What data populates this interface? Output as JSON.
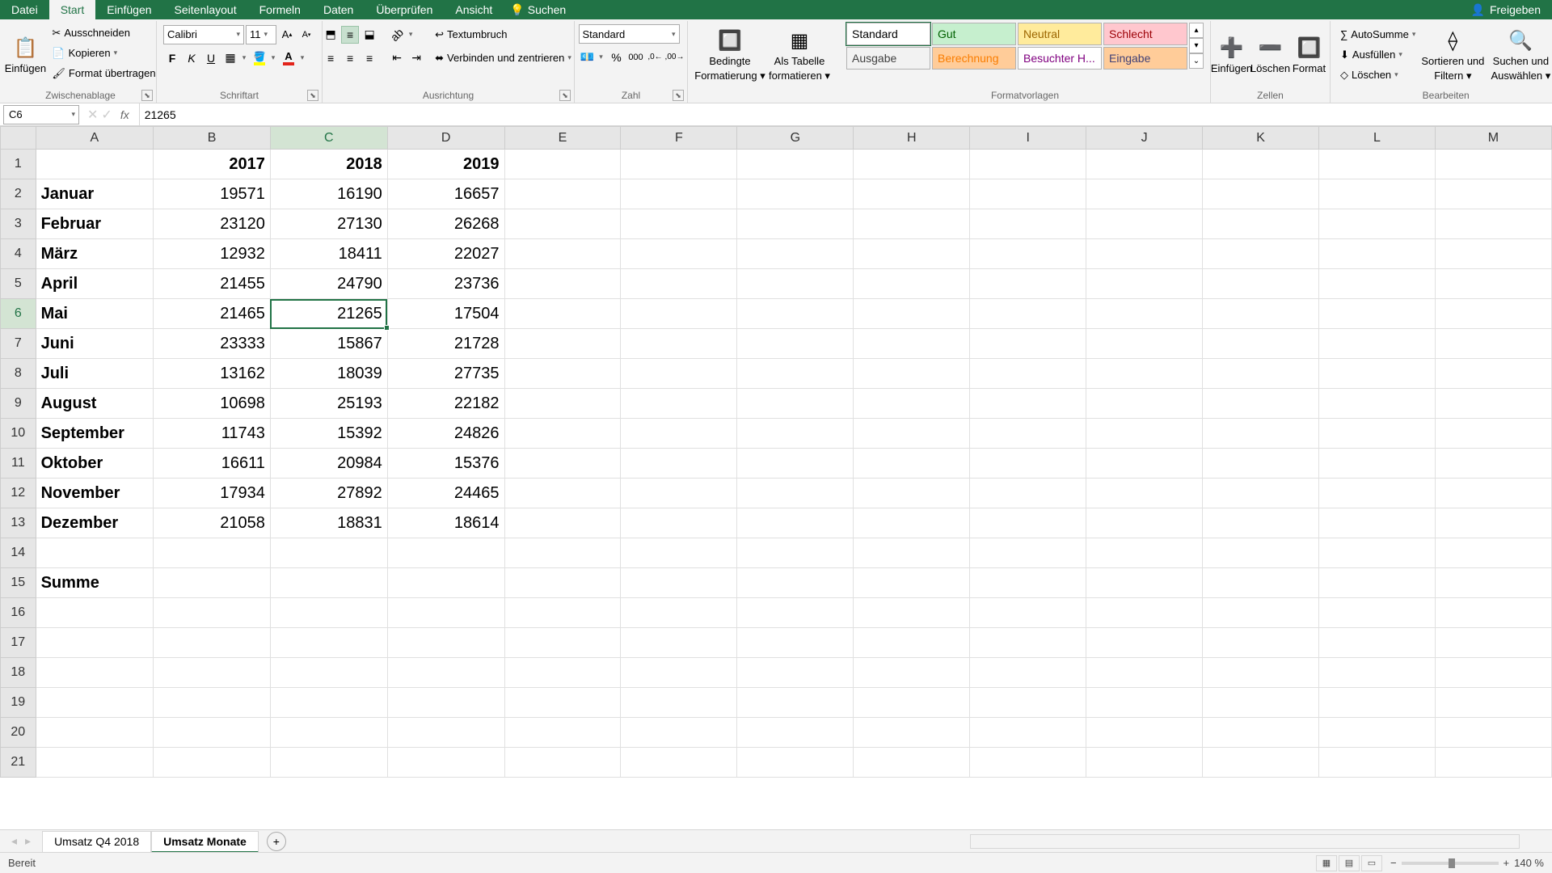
{
  "title_tabs": [
    "Datei",
    "Start",
    "Einfügen",
    "Seitenlayout",
    "Formeln",
    "Daten",
    "Überprüfen",
    "Ansicht"
  ],
  "active_tab": "Start",
  "search_label": "Suchen",
  "share_label": "Freigeben",
  "clipboard": {
    "paste": "Einfügen",
    "cut": "Ausschneiden",
    "copy": "Kopieren",
    "format_paint": "Format übertragen",
    "group": "Zwischenablage"
  },
  "font": {
    "group": "Schriftart",
    "name": "Calibri",
    "size": "11"
  },
  "alignment": {
    "group": "Ausrichtung",
    "wrap": "Textumbruch",
    "merge": "Verbinden und zentrieren"
  },
  "number": {
    "group": "Zahl",
    "format": "Standard"
  },
  "cond_format": {
    "btn1a": "Bedingte",
    "btn1b": "Formatierung",
    "btn2a": "Als Tabelle",
    "btn2b": "formatieren"
  },
  "styles": {
    "group": "Formatvorlagen",
    "items": [
      "Standard",
      "Gut",
      "Neutral",
      "Schlecht",
      "Ausgabe",
      "Berechnung",
      "Besuchter H...",
      "Eingabe"
    ]
  },
  "cells": {
    "group": "Zellen",
    "ins": "Einfügen",
    "del": "Löschen",
    "fmt": "Format"
  },
  "editing": {
    "group": "Bearbeiten",
    "sum": "AutoSumme",
    "fill": "Ausfüllen",
    "clear": "Löschen",
    "sort1": "Sortieren und",
    "sort2": "Filtern",
    "find1": "Suchen und",
    "find2": "Auswählen"
  },
  "namebox": "C6",
  "formula_value": "21265",
  "columns": [
    "A",
    "B",
    "C",
    "D",
    "E",
    "F",
    "G",
    "H",
    "I",
    "J",
    "K",
    "L",
    "M"
  ],
  "rows": 21,
  "selected": {
    "row": 6,
    "col": "C"
  },
  "data": {
    "B1": "2017",
    "C1": "2018",
    "D1": "2019",
    "A2": "Januar",
    "B2": "19571",
    "C2": "16190",
    "D2": "16657",
    "A3": "Februar",
    "B3": "23120",
    "C3": "27130",
    "D3": "26268",
    "A4": "März",
    "B4": "12932",
    "C4": "18411",
    "D4": "22027",
    "A5": "April",
    "B5": "21455",
    "C5": "24790",
    "D5": "23736",
    "A6": "Mai",
    "B6": "21465",
    "C6": "21265",
    "D6": "17504",
    "A7": "Juni",
    "B7": "23333",
    "C7": "15867",
    "D7": "21728",
    "A8": "Juli",
    "B8": "13162",
    "C8": "18039",
    "D8": "27735",
    "A9": "August",
    "B9": "10698",
    "C9": "25193",
    "D9": "22182",
    "A10": "September",
    "B10": "11743",
    "C10": "15392",
    "D10": "24826",
    "A11": "Oktober",
    "B11": "16611",
    "C11": "20984",
    "D11": "15376",
    "A12": "November",
    "B12": "17934",
    "C12": "27892",
    "D12": "24465",
    "A13": "Dezember",
    "B13": "21058",
    "C13": "18831",
    "D13": "18614",
    "A15": "Summe"
  },
  "bold_cells": [
    "B1",
    "C1",
    "D1",
    "A2",
    "A3",
    "A4",
    "A5",
    "A6",
    "A7",
    "A8",
    "A9",
    "A10",
    "A11",
    "A12",
    "A13",
    "A15"
  ],
  "sheets": [
    "Umsatz Q4 2018",
    "Umsatz Monate"
  ],
  "active_sheet": "Umsatz Monate",
  "status": "Bereit",
  "zoom": "140 %"
}
